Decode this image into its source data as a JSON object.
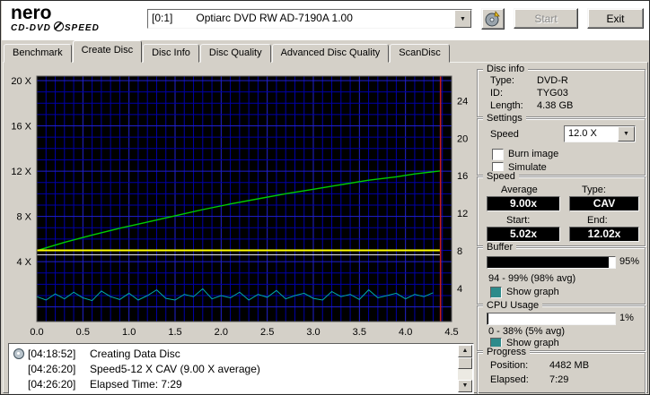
{
  "header": {
    "logo_title": "nero",
    "logo_sub1": "CD-DVD",
    "logo_sub2": "SPEED",
    "drive_id": "[0:1]",
    "drive_name": "Optiarc DVD RW AD-7190A 1.00",
    "start_button": "Start",
    "exit_button": "Exit"
  },
  "tabs": [
    {
      "label": "Benchmark"
    },
    {
      "label": "Create Disc"
    },
    {
      "label": "Disc Info"
    },
    {
      "label": "Disc Quality"
    },
    {
      "label": "Advanced Disc Quality"
    },
    {
      "label": "ScanDisc"
    }
  ],
  "chart_data": {
    "type": "line",
    "title": "",
    "xlabel": "",
    "ylabel": "",
    "x_range": [
      0,
      4.5
    ],
    "y_range": [
      -1.3,
      20.4
    ],
    "x_ticks": [
      "0.0",
      "0.5",
      "1.0",
      "1.5",
      "2.0",
      "2.5",
      "3.0",
      "3.5",
      "4.0",
      "4.5"
    ],
    "y_left_ticks": [
      "20 X",
      "16 X",
      "12 X",
      "8 X",
      "4 X"
    ],
    "y_left_values": [
      20,
      16,
      12,
      8,
      4
    ],
    "y_right_ticks": [
      "24",
      "20",
      "16",
      "12",
      "8",
      "4"
    ],
    "y_right_fractions": [
      0.1,
      0.253,
      0.406,
      0.559,
      0.712,
      0.865
    ],
    "bg_color": "#000000",
    "grid_minor": "#0000a8",
    "grid_major": "#2121d0",
    "end_marker": {
      "x": 4.38,
      "color": "#c22020"
    },
    "series": [
      {
        "name": "write-speed",
        "color": "#00cc00",
        "width": 1.4,
        "points": [
          [
            0.02,
            5.02
          ],
          [
            0.3,
            5.7
          ],
          [
            0.6,
            6.35
          ],
          [
            0.9,
            6.95
          ],
          [
            1.2,
            7.5
          ],
          [
            1.5,
            8.05
          ],
          [
            1.8,
            8.6
          ],
          [
            2.1,
            9.1
          ],
          [
            2.4,
            9.55
          ],
          [
            2.7,
            10.0
          ],
          [
            3.0,
            10.4
          ],
          [
            3.3,
            10.8
          ],
          [
            3.6,
            11.2
          ],
          [
            3.9,
            11.5
          ],
          [
            4.1,
            11.75
          ],
          [
            4.38,
            12.02
          ]
        ]
      },
      {
        "name": "requested-speed",
        "color": "#ffff00",
        "width": 2,
        "points": [
          [
            0,
            5.0
          ],
          [
            4.38,
            5.0
          ]
        ]
      },
      {
        "name": "secondary-line",
        "color": "#e8e8e8",
        "width": 1,
        "points": [
          [
            0,
            4.6
          ],
          [
            4.38,
            4.6
          ]
        ]
      },
      {
        "name": "cpu-usage",
        "color": "#00a8a8",
        "width": 1,
        "points": [
          [
            0,
            0.9
          ],
          [
            0.1,
            0.6
          ],
          [
            0.2,
            1.15
          ],
          [
            0.3,
            0.7
          ],
          [
            0.4,
            1.3
          ],
          [
            0.5,
            0.8
          ],
          [
            0.6,
            0.55
          ],
          [
            0.7,
            1.4
          ],
          [
            0.8,
            0.9
          ],
          [
            0.9,
            0.65
          ],
          [
            1.0,
            1.2
          ],
          [
            1.1,
            0.6
          ],
          [
            1.2,
            1.0
          ],
          [
            1.3,
            1.5
          ],
          [
            1.4,
            0.75
          ],
          [
            1.5,
            0.6
          ],
          [
            1.6,
            1.1
          ],
          [
            1.7,
            0.9
          ],
          [
            1.8,
            1.6
          ],
          [
            1.9,
            0.7
          ],
          [
            2.0,
            1.0
          ],
          [
            2.1,
            0.8
          ],
          [
            2.2,
            1.3
          ],
          [
            2.3,
            0.6
          ],
          [
            2.4,
            1.1
          ],
          [
            2.5,
            0.85
          ],
          [
            2.6,
            1.45
          ],
          [
            2.7,
            0.7
          ],
          [
            2.8,
            1.0
          ],
          [
            2.9,
            1.2
          ],
          [
            3.0,
            0.75
          ],
          [
            3.1,
            0.6
          ],
          [
            3.2,
            1.35
          ],
          [
            3.3,
            0.9
          ],
          [
            3.4,
            1.1
          ],
          [
            3.5,
            0.65
          ],
          [
            3.6,
            1.5
          ],
          [
            3.7,
            0.8
          ],
          [
            3.8,
            1.0
          ],
          [
            3.9,
            1.2
          ],
          [
            4.0,
            0.7
          ],
          [
            4.1,
            1.1
          ],
          [
            4.2,
            0.9
          ],
          [
            4.3,
            1.25
          ]
        ]
      }
    ]
  },
  "panels": {
    "disc_info": {
      "title": "Disc info",
      "rows": [
        {
          "label": "Type:",
          "value": "DVD-R"
        },
        {
          "label": "ID:",
          "value": "TYG03"
        },
        {
          "label": "Length:",
          "value": "4.38 GB"
        }
      ]
    },
    "settings": {
      "title": "Settings",
      "speed_label": "Speed",
      "speed_value": "12.0 X",
      "checkboxes": [
        {
          "label": "Burn image",
          "checked": false
        },
        {
          "label": "Simulate",
          "checked": false
        }
      ]
    },
    "speed": {
      "title": "Speed",
      "average_label": "Average",
      "average_value": "9.00x",
      "type_label": "Type:",
      "type_value": "CAV",
      "start_label": "Start:",
      "start_value": "5.02x",
      "end_label": "End:",
      "end_value": "12.02x"
    },
    "buffer": {
      "title": "Buffer",
      "bar_percent": 95,
      "percent_label": "95%",
      "range_text": "94 - 99% (98% avg)",
      "show_graph_label": "Show graph",
      "swatch_color": "#2e8b8b"
    },
    "cpu": {
      "title": "CPU Usage",
      "bar_percent": 1,
      "percent_label": "1%",
      "range_text": "0 - 38% (5% avg)",
      "show_graph_label": "Show graph",
      "swatch_color": "#2e8b8b"
    },
    "progress": {
      "title": "Progress",
      "position_label": "Position:",
      "position_value": "4482 MB",
      "elapsed_label": "Elapsed:",
      "elapsed_value": "7:29"
    }
  },
  "log": {
    "entries": [
      {
        "time": "[04:18:52]",
        "text": "Creating Data Disc"
      },
      {
        "time": "[04:26:20]",
        "text": "Speed5-12 X CAV (9.00 X average)"
      },
      {
        "time": "[04:26:20]",
        "text": "Elapsed Time: 7:29"
      }
    ]
  }
}
